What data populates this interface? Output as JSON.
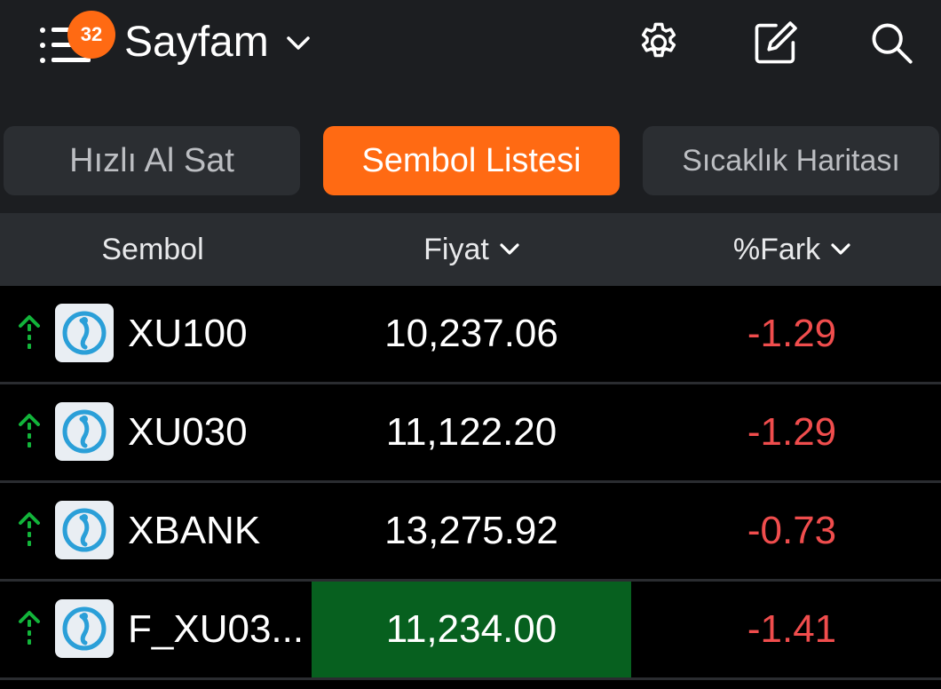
{
  "header": {
    "notification_count": "32",
    "title": "Sayfam",
    "icons": [
      "menu-icon",
      "chevron-down-icon",
      "gear-icon",
      "edit-icon",
      "search-icon"
    ]
  },
  "tabs": [
    {
      "label": "Hızlı Al Sat",
      "active": false
    },
    {
      "label": "Sembol Listesi",
      "active": true
    },
    {
      "label": "Sıcaklık Haritası",
      "active": false
    }
  ],
  "columns": {
    "symbol": "Sembol",
    "price": "Fiyat",
    "change": "%Fark"
  },
  "rows": [
    {
      "symbol": "XU100",
      "price": "10,237.06",
      "change": "-1.29",
      "trend": "up"
    },
    {
      "symbol": "XU030",
      "price": "11,122.20",
      "change": "-1.29",
      "trend": "up"
    },
    {
      "symbol": "XBANK",
      "price": "13,275.92",
      "change": "-0.73",
      "trend": "up"
    },
    {
      "symbol": "F_XU03...",
      "price": "11,234.00",
      "change": "-1.41",
      "trend": "up"
    }
  ],
  "colors": {
    "accent": "#ff6a13",
    "negative": "#f04d4d",
    "positive_arrow": "#12b43a",
    "flash_up": "#07601f"
  }
}
